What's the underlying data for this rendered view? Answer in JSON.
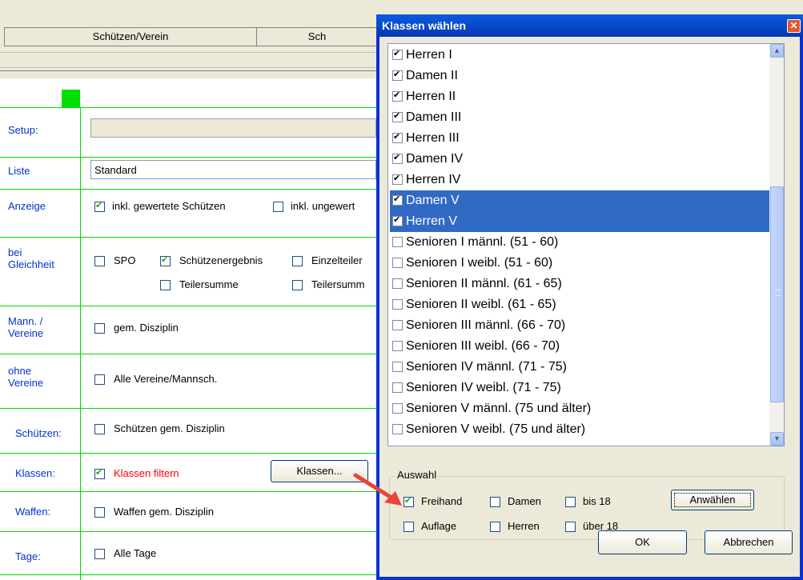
{
  "background": {
    "title_fragment": "",
    "tabs": [
      "Schützen/Verein",
      "Sch"
    ],
    "labels": {
      "setup": "Setup:",
      "liste": "Liste",
      "anzeige": "Anzeige",
      "gleichheit": "bei\nGleichheit",
      "mann": "Mann. /\nVereine",
      "ohne": "ohne\nVereine",
      "schuetzen": "Schützen:",
      "klassen": "Klassen:",
      "waffen": "Waffen:",
      "tage": "Tage:"
    },
    "setup_value": "",
    "liste_value": "Standard",
    "checkboxes": {
      "inkl_gewertete": {
        "label": "inkl. gewertete Schützen",
        "checked": true
      },
      "inkl_ungewertete": {
        "label": "inkl. ungewert",
        "checked": false
      },
      "spo": {
        "label": "SPO",
        "checked": false
      },
      "schuetzenergebnis": {
        "label": "Schützenergebnis",
        "checked": true
      },
      "einzelteiler": {
        "label": "Einzelteiler",
        "checked": false
      },
      "teilersumme": {
        "label": "Teilersumme",
        "checked": false
      },
      "teilersumme2": {
        "label": "Teilersumm",
        "checked": false
      },
      "gem_disziplin": {
        "label": "gem. Disziplin",
        "checked": false
      },
      "alle_vereine": {
        "label": "Alle Vereine/Mannsch.",
        "checked": false
      },
      "schuetzen_gem": {
        "label": "Schützen gem. Disziplin",
        "checked": false
      },
      "klassen_filtern": {
        "label": "Klassen filtern",
        "checked": true
      },
      "waffen_gem": {
        "label": "Waffen gem. Disziplin",
        "checked": false
      },
      "alle_tage": {
        "label": "Alle Tage",
        "checked": false
      }
    },
    "klassen_button": "Klassen..."
  },
  "dialog": {
    "title": "Klassen wählen",
    "close": "✕",
    "list_items": [
      {
        "label": "Herren I",
        "checked": true,
        "selected": false
      },
      {
        "label": "Damen II",
        "checked": true,
        "selected": false
      },
      {
        "label": "Herren II",
        "checked": true,
        "selected": false
      },
      {
        "label": "Damen III",
        "checked": true,
        "selected": false
      },
      {
        "label": "Herren III",
        "checked": true,
        "selected": false
      },
      {
        "label": "Damen IV",
        "checked": true,
        "selected": false
      },
      {
        "label": "Herren IV",
        "checked": true,
        "selected": false
      },
      {
        "label": "Damen V",
        "checked": true,
        "selected": true
      },
      {
        "label": "Herren V",
        "checked": true,
        "selected": true
      },
      {
        "label": "Senioren I männl. (51 - 60)",
        "checked": false,
        "selected": false
      },
      {
        "label": "Senioren I weibl. (51 - 60)",
        "checked": false,
        "selected": false
      },
      {
        "label": "Senioren II männl. (61 - 65)",
        "checked": false,
        "selected": false
      },
      {
        "label": "Senioren II weibl. (61 - 65)",
        "checked": false,
        "selected": false
      },
      {
        "label": "Senioren III männl. (66 - 70)",
        "checked": false,
        "selected": false
      },
      {
        "label": "Senioren III weibl. (66 - 70)",
        "checked": false,
        "selected": false
      },
      {
        "label": "Senioren IV männl. (71 - 75)",
        "checked": false,
        "selected": false
      },
      {
        "label": "Senioren IV weibl. (71 - 75)",
        "checked": false,
        "selected": false
      },
      {
        "label": "Senioren V männl. (75 und älter)",
        "checked": false,
        "selected": false
      },
      {
        "label": "Senioren V weibl. (75 und älter)",
        "checked": false,
        "selected": false
      }
    ],
    "auswahl": {
      "legend": "Auswahl",
      "freihand": {
        "label": "Freihand",
        "checked": true
      },
      "damen": {
        "label": "Damen",
        "checked": false
      },
      "bis18": {
        "label": "bis 18",
        "checked": false
      },
      "auflage": {
        "label": "Auflage",
        "checked": false
      },
      "herren": {
        "label": "Herren",
        "checked": false
      },
      "ueber18": {
        "label": "über 18",
        "checked": false
      },
      "anwaehlen": "Anwählen"
    },
    "ok": "OK",
    "cancel": "Abbrechen"
  },
  "colors": {
    "selection": "#316ac5",
    "grid_green": "#00dd00",
    "label_blue": "#0033cc",
    "arrow_red": "#e8463c",
    "title_blue": "#0846c8"
  }
}
